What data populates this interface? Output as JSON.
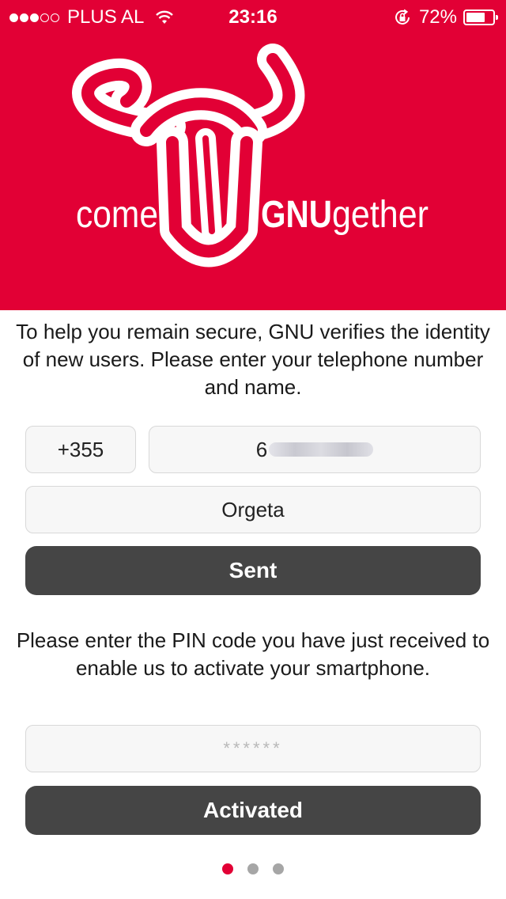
{
  "colors": {
    "brand_red": "#E20035",
    "button_dark": "#454545",
    "dot_inactive": "#a6a6a6"
  },
  "status_bar": {
    "signal_bars_filled": 3,
    "signal_bars_total": 5,
    "carrier": "PLUS AL",
    "time": "23:16",
    "battery_percent": "72%",
    "battery_level": 0.72,
    "icons": [
      "signal-dots-icon",
      "wifi-icon",
      "rotation-lock-icon",
      "battery-icon"
    ]
  },
  "logo": {
    "left_text": "come",
    "bold_text": "GNU",
    "right_text": "gether"
  },
  "intro_text": "To help you remain secure, GNU verifies the identity of new users. Please enter your telephone number and name.",
  "form": {
    "country_code": "+355",
    "phone_visible": "6",
    "name": "Orgeta",
    "send_label": "Sent"
  },
  "pin_text": "Please enter the PIN code you have just received to enable us to activate your smartphone.",
  "pin": {
    "placeholder": "******",
    "activate_label": "Activated"
  },
  "pager": {
    "count": 3,
    "active_index": 0
  }
}
